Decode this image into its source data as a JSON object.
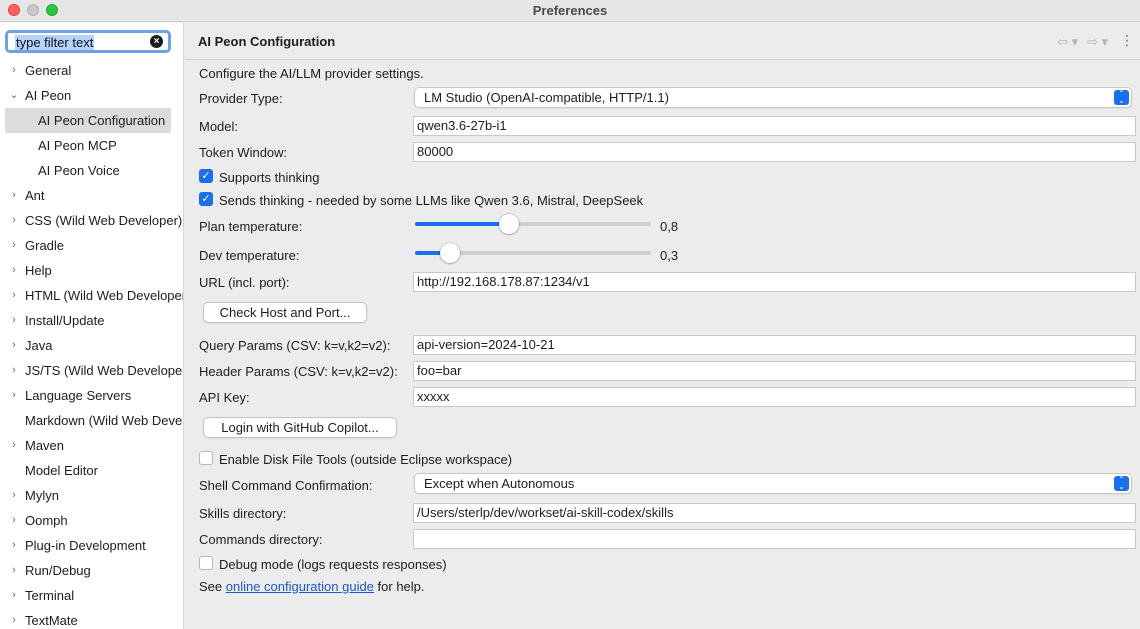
{
  "window": {
    "title": "Preferences"
  },
  "sidebar": {
    "filter_text": "type filter text",
    "items": [
      {
        "label": "General",
        "chevron": "›",
        "level": 0
      },
      {
        "label": "AI Peon",
        "chevron": "⌄",
        "level": 0
      },
      {
        "label": "AI Peon Configuration",
        "chevron": "",
        "level": 1,
        "selected": true
      },
      {
        "label": "AI Peon MCP",
        "chevron": "",
        "level": 1
      },
      {
        "label": "AI Peon Voice",
        "chevron": "",
        "level": 1
      },
      {
        "label": "Ant",
        "chevron": "›",
        "level": 0
      },
      {
        "label": "CSS (Wild Web Developer)",
        "chevron": "›",
        "level": 0
      },
      {
        "label": "Gradle",
        "chevron": "›",
        "level": 0
      },
      {
        "label": "Help",
        "chevron": "›",
        "level": 0
      },
      {
        "label": "HTML (Wild Web Developer)",
        "chevron": "›",
        "level": 0
      },
      {
        "label": "Install/Update",
        "chevron": "›",
        "level": 0
      },
      {
        "label": "Java",
        "chevron": "›",
        "level": 0
      },
      {
        "label": "JS/TS (Wild Web Developer)",
        "chevron": "›",
        "level": 0
      },
      {
        "label": "Language Servers",
        "chevron": "›",
        "level": 0
      },
      {
        "label": "Markdown (Wild Web Developer)",
        "chevron": "",
        "level": 0
      },
      {
        "label": "Maven",
        "chevron": "›",
        "level": 0
      },
      {
        "label": "Model Editor",
        "chevron": "",
        "level": 0
      },
      {
        "label": "Mylyn",
        "chevron": "›",
        "level": 0
      },
      {
        "label": "Oomph",
        "chevron": "›",
        "level": 0
      },
      {
        "label": "Plug-in Development",
        "chevron": "›",
        "level": 0
      },
      {
        "label": "Run/Debug",
        "chevron": "›",
        "level": 0
      },
      {
        "label": "Terminal",
        "chevron": "›",
        "level": 0
      },
      {
        "label": "TextMate",
        "chevron": "›",
        "level": 0
      }
    ]
  },
  "header": {
    "title": "AI Peon Configuration",
    "back_icon": "⇦ ▾",
    "forward_icon": "⇨ ▾",
    "menu_icon": "⋮"
  },
  "form": {
    "intro": "Configure the AI/LLM provider settings.",
    "provider_label": "Provider Type:",
    "provider_value": "LM Studio (OpenAI-compatible, HTTP/1.1)",
    "model_label": "Model:",
    "model_value": "qwen3.6-27b-i1",
    "token_label": "Token Window:",
    "token_value": "80000",
    "supports_thinking_label": "Supports thinking",
    "supports_thinking_checked": true,
    "sends_thinking_label": "Sends thinking - needed by some LLMs like Qwen 3.6, Mistral, DeepSeek",
    "sends_thinking_checked": true,
    "plan_temp_label": "Plan temperature:",
    "plan_temp_value": "0,8",
    "plan_temp_level": 0.4,
    "dev_temp_label": "Dev temperature:",
    "dev_temp_value": "0,3",
    "dev_temp_level": 0.15,
    "url_label": "URL (incl. port):",
    "url_value": "http://192.168.178.87:1234/v1",
    "check_button": "Check Host and Port...",
    "query_label": "Query Params (CSV: k=v,k2=v2):",
    "query_value": "api-version=2024-10-21",
    "header_label": "Header Params (CSV: k=v,k2=v2):",
    "header_value": "foo=bar",
    "apikey_label": "API Key:",
    "apikey_value": "xxxxx",
    "copilot_button": "Login with GitHub Copilot...",
    "disk_tools_label": "Enable Disk File Tools (outside Eclipse workspace)",
    "disk_tools_checked": false,
    "shell_label": "Shell Command Confirmation:",
    "shell_value": "Except when Autonomous",
    "skills_label": "Skills directory:",
    "skills_value": "/Users/sterlp/dev/workset/ai-skill-codex/skills",
    "commands_label": "Commands directory:",
    "commands_value": "",
    "debug_label": "Debug mode (logs requests  responses)",
    "debug_checked": false,
    "footer_see": "See ",
    "footer_link": "online configuration guide",
    "footer_help": " for help."
  },
  "colors": {
    "accent": "#1a6ff0",
    "selection": "#dcdcdc",
    "link": "#1a59c8"
  }
}
